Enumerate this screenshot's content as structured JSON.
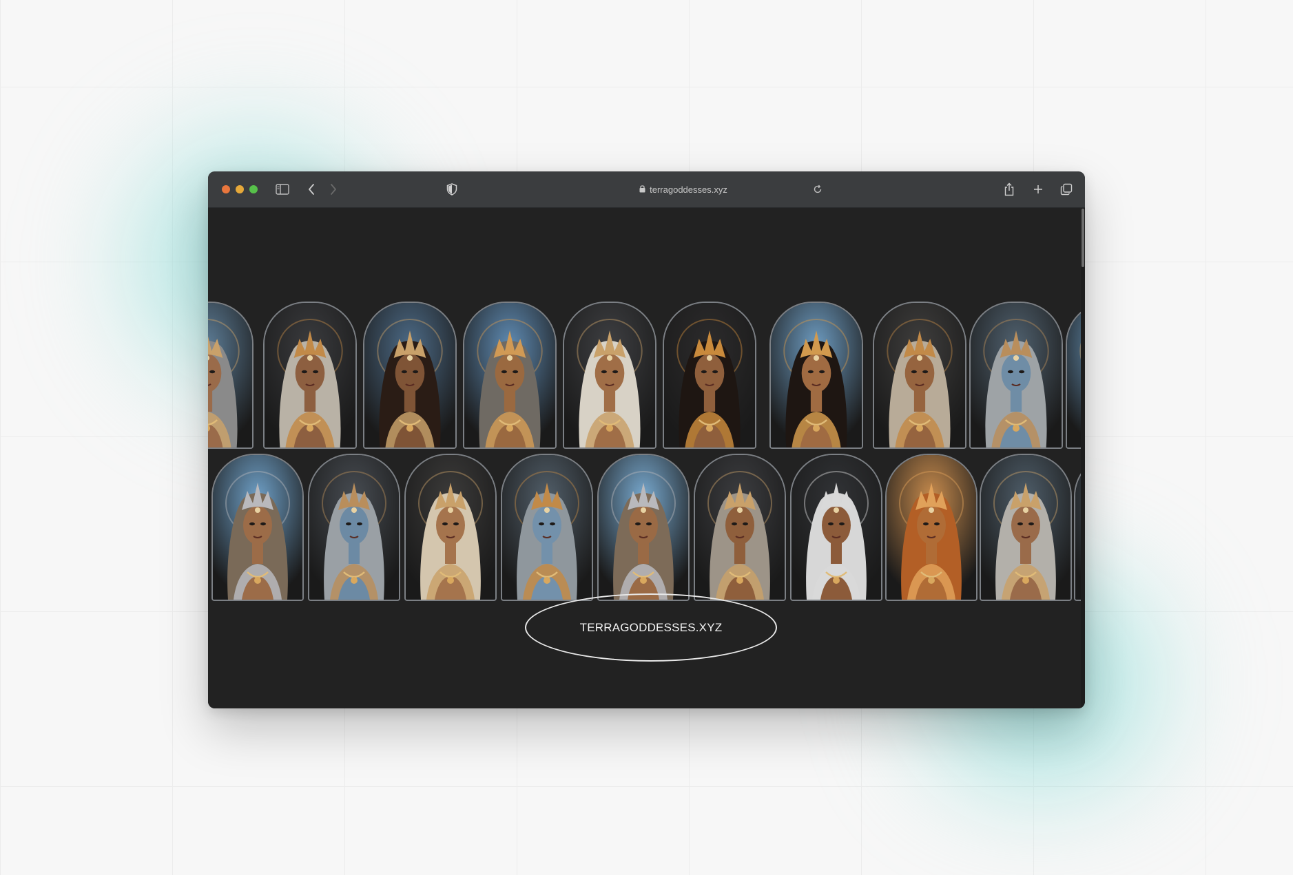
{
  "browser": {
    "url": "terragoddesses.xyz",
    "icons": {
      "sidebar": "sidebar-icon",
      "back": "chevron-left-icon",
      "forward": "chevron-right-icon",
      "privacy": "shield-icon",
      "lock": "lock-icon",
      "reload": "reload-icon",
      "share": "share-icon",
      "new_tab": "plus-icon",
      "tabs": "tabs-overview-icon"
    },
    "traffic_lights": [
      "#e8763d",
      "#e6a93a",
      "#57c14a"
    ]
  },
  "page": {
    "logo_text": "TERRAGODDESSES.XYZ",
    "background": "#222222",
    "gallery_rows": [
      {
        "cards": [
          {
            "theme": "silver-horned",
            "bg": "#5d7d97",
            "skin": "#9a6b4a",
            "hair": "#8a8a8a",
            "crown": "#c9a16a"
          },
          {
            "theme": "bronze-curly",
            "bg": "#3a3b3e",
            "skin": "#8d5f40",
            "hair": "#b9b2a6",
            "crown": "#c28a48"
          },
          {
            "theme": "dark-hair-headdress",
            "bg": "#4c6a86",
            "skin": "#7f5436",
            "hair": "#2a1c15",
            "crown": "#c9a16a"
          },
          {
            "theme": "blue-sky-bronze",
            "bg": "#5f8bb3",
            "skin": "#9a6940",
            "hair": "#6f6a63",
            "crown": "#d19a55"
          },
          {
            "theme": "white-hair-gold",
            "bg": "#3e3f42",
            "skin": "#a06e47",
            "hair": "#d8d2c6",
            "crown": "#c9a16a"
          },
          {
            "theme": "golden-horns",
            "bg": "#2c2b2c",
            "skin": "#8f5f3c",
            "hair": "#1e1612",
            "crown": "#c98a3c"
          },
          {
            "theme": "sun-halo",
            "bg": "#6d9bc0",
            "skin": "#a06b42",
            "hair": "#1e1612",
            "crown": "#d29a4e"
          },
          {
            "theme": "braided-bronze",
            "bg": "#3f3e3d",
            "skin": "#96643f",
            "hair": "#b8ab98",
            "crown": "#c28a48"
          },
          {
            "theme": "blue-face-silver",
            "bg": "#50616f",
            "skin": "#6f8da6",
            "hair": "#9ea3a6",
            "crown": "#b98e5c"
          },
          {
            "theme": "partial-blue",
            "bg": "#6ea0c8",
            "skin": "#a57250",
            "hair": "#a8a8a8",
            "crown": "#c9a16a"
          }
        ]
      },
      {
        "cards": [
          {
            "theme": "silver-horned-braids",
            "bg": "#6e9fc6",
            "skin": "#9c6c48",
            "hair": "#7a6a58",
            "crown": "#b9b9bd"
          },
          {
            "theme": "blue-face-grey",
            "bg": "#474c52",
            "skin": "#6c8aa4",
            "hair": "#9aa0a5",
            "crown": "#b98e5c"
          },
          {
            "theme": "blonde-braids",
            "bg": "#3c3b3a",
            "skin": "#a5744d",
            "hair": "#d4c6ae",
            "crown": "#c9a16a"
          },
          {
            "theme": "blue-face-bronze",
            "bg": "#515e69",
            "skin": "#7391ab",
            "hair": "#8f979d",
            "crown": "#c28a48"
          },
          {
            "theme": "horned-sky",
            "bg": "#78a9cf",
            "skin": "#9a6a45",
            "hair": "#7d6b58",
            "crown": "#b9b9bd"
          },
          {
            "theme": "bronze-crown",
            "bg": "#3c3d40",
            "skin": "#8f5f3c",
            "hair": "#9d9488",
            "crown": "#c9a16a"
          },
          {
            "theme": "silver-sunburst",
            "bg": "#313336",
            "skin": "#8c5b3a",
            "hair": "#d7d7d7",
            "crown": "#d9d9d9"
          },
          {
            "theme": "copper-radiant",
            "bg": "#c78b4d",
            "skin": "#b06c36",
            "hair": "#b35f26",
            "crown": "#e0a15a"
          },
          {
            "theme": "silver-wavy",
            "bg": "#4e5d69",
            "skin": "#9a6b4a",
            "hair": "#b3b0aa",
            "crown": "#c9a16a"
          },
          {
            "theme": "partial-dark",
            "bg": "#4a5865",
            "skin": "#9a6b4a",
            "hair": "#9d9d9d",
            "crown": "#c9a16a"
          }
        ]
      }
    ]
  }
}
